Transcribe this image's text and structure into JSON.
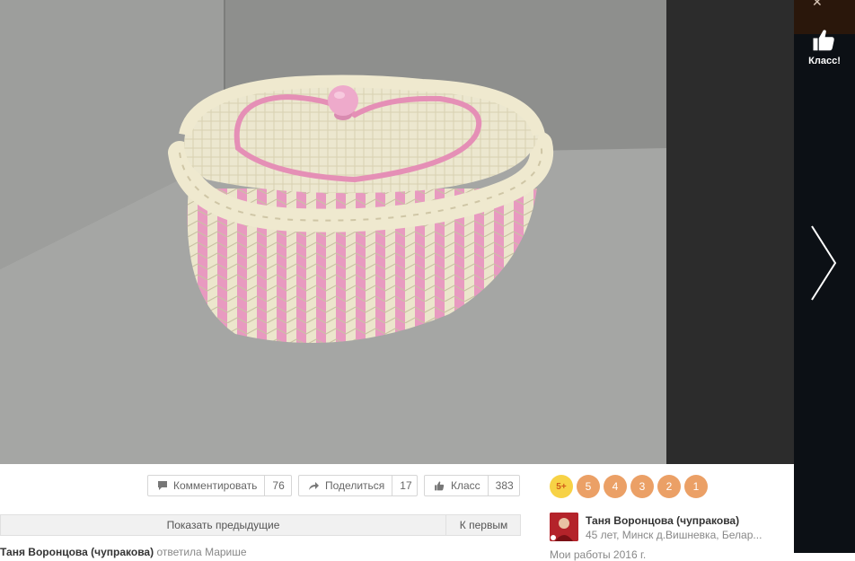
{
  "side_panel": {
    "like_label": "Класс!"
  },
  "actions": {
    "comment_label": "Комментировать",
    "comment_count": "76",
    "share_label": "Поделиться",
    "share_count": "17",
    "class_label": "Класс",
    "class_count": "383"
  },
  "comments_nav": {
    "show_previous": "Показать предыдущие",
    "to_first": "К первым"
  },
  "comment_preview": {
    "author": "Таня Воронцова (чупракова)",
    "action": "ответила Марише"
  },
  "ratings": [
    "5+",
    "5",
    "4",
    "3",
    "2",
    "1"
  ],
  "author": {
    "name": "Таня Воронцова (чупракова)",
    "info": "45 лет, Минск д.Вишневка, Белар...",
    "date": "Мои работы 2016 г."
  },
  "colors": {
    "rating_bg": "#eba066",
    "rating_plus_bg": "#f7d246",
    "side_bg": "#0c1015"
  },
  "icons": {
    "like": "thumbs-up-icon",
    "next": "chevron-right-icon",
    "comment": "speech-bubble-icon",
    "share": "share-arrow-icon"
  }
}
